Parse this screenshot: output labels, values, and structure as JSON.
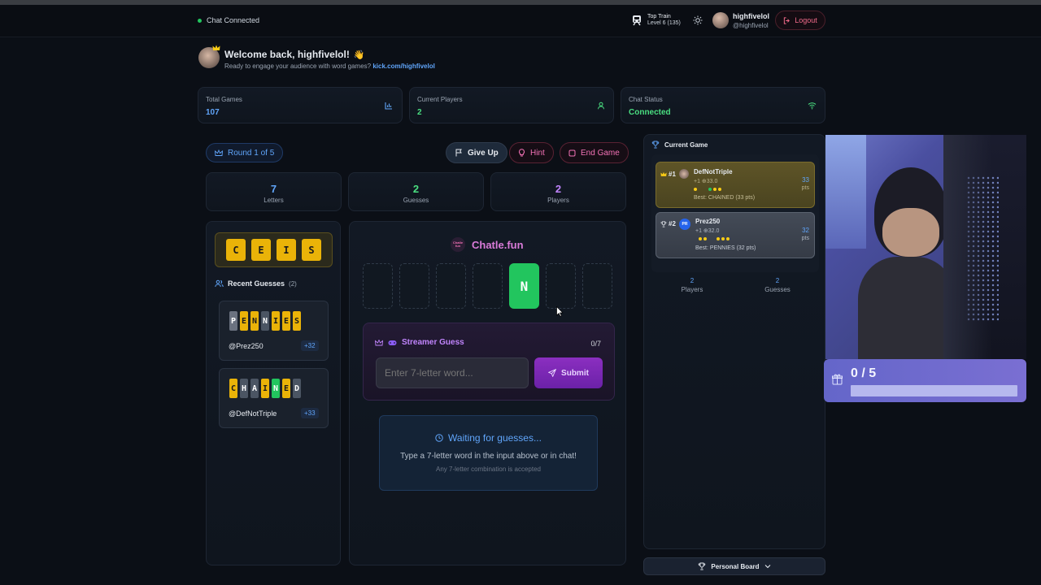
{
  "topbar": {
    "chat_status": "Chat Connected",
    "train_title": "Top Train",
    "train_level": "Level 6 (135)",
    "username": "highfivelol",
    "handle": "@highfivelol",
    "logout": "Logout"
  },
  "welcome": {
    "title": "Welcome back, highfivelol!",
    "emoji": "👋",
    "subtitle": "Ready to engage your audience with word games?",
    "link": "kick.com/highfivelol"
  },
  "stats": [
    {
      "label": "Total Games",
      "value": "107"
    },
    {
      "label": "Current Players",
      "value": "2"
    },
    {
      "label": "Chat Status",
      "value": "Connected"
    }
  ],
  "round": "Round 1 of 5",
  "actions": {
    "give_up": "Give Up",
    "hint": "Hint",
    "end_game": "End Game"
  },
  "summary": [
    {
      "value": "7",
      "label": "Letters"
    },
    {
      "value": "2",
      "label": "Guesses"
    },
    {
      "value": "2",
      "label": "Players"
    }
  ],
  "letters": [
    "C",
    "E",
    "I",
    "S"
  ],
  "recent": {
    "title": "Recent Guesses",
    "count": "(2)",
    "items": [
      {
        "word": [
          "P",
          "E",
          "N",
          "N",
          "I",
          "E",
          "S"
        ],
        "user": "@Prez250",
        "points": "+32"
      },
      {
        "word": [
          "C",
          "H",
          "A",
          "I",
          "N",
          "E",
          "D"
        ],
        "user": "@DefNotTriple",
        "points": "+33"
      }
    ]
  },
  "brand": {
    "name": "Chatle.fun",
    "logo_text": "Chatle fun"
  },
  "board": {
    "revealed_letter": "N"
  },
  "streamer": {
    "title": "Streamer Guess",
    "count": "0/7",
    "placeholder": "Enter 7-letter word...",
    "submit": "Submit"
  },
  "waiting": {
    "title": "Waiting for guesses...",
    "line1": "Type a 7-letter word in the input above or in chat!",
    "line2": "Any 7-letter combination is accepted"
  },
  "current_game": {
    "title": "Current Game",
    "players": [
      {
        "rank": "#1",
        "name": "DefNotTriple",
        "meta": "+1 ⊕33.0",
        "points": "33",
        "unit": "pts",
        "best": "Best: CHAINED (33 pts)"
      },
      {
        "rank": "#2",
        "initials": "PR",
        "name": "Prez250",
        "meta": "+1 ⊕32.0",
        "points": "32",
        "unit": "pts",
        "best": "Best: PENNIES (32 pts)"
      }
    ],
    "footer": [
      {
        "value": "2",
        "label": "Players"
      },
      {
        "value": "2",
        "label": "Guesses"
      }
    ]
  },
  "personal_board": "Personal Board",
  "gift_goal": {
    "text": "0 / 5",
    "progress": 0
  }
}
